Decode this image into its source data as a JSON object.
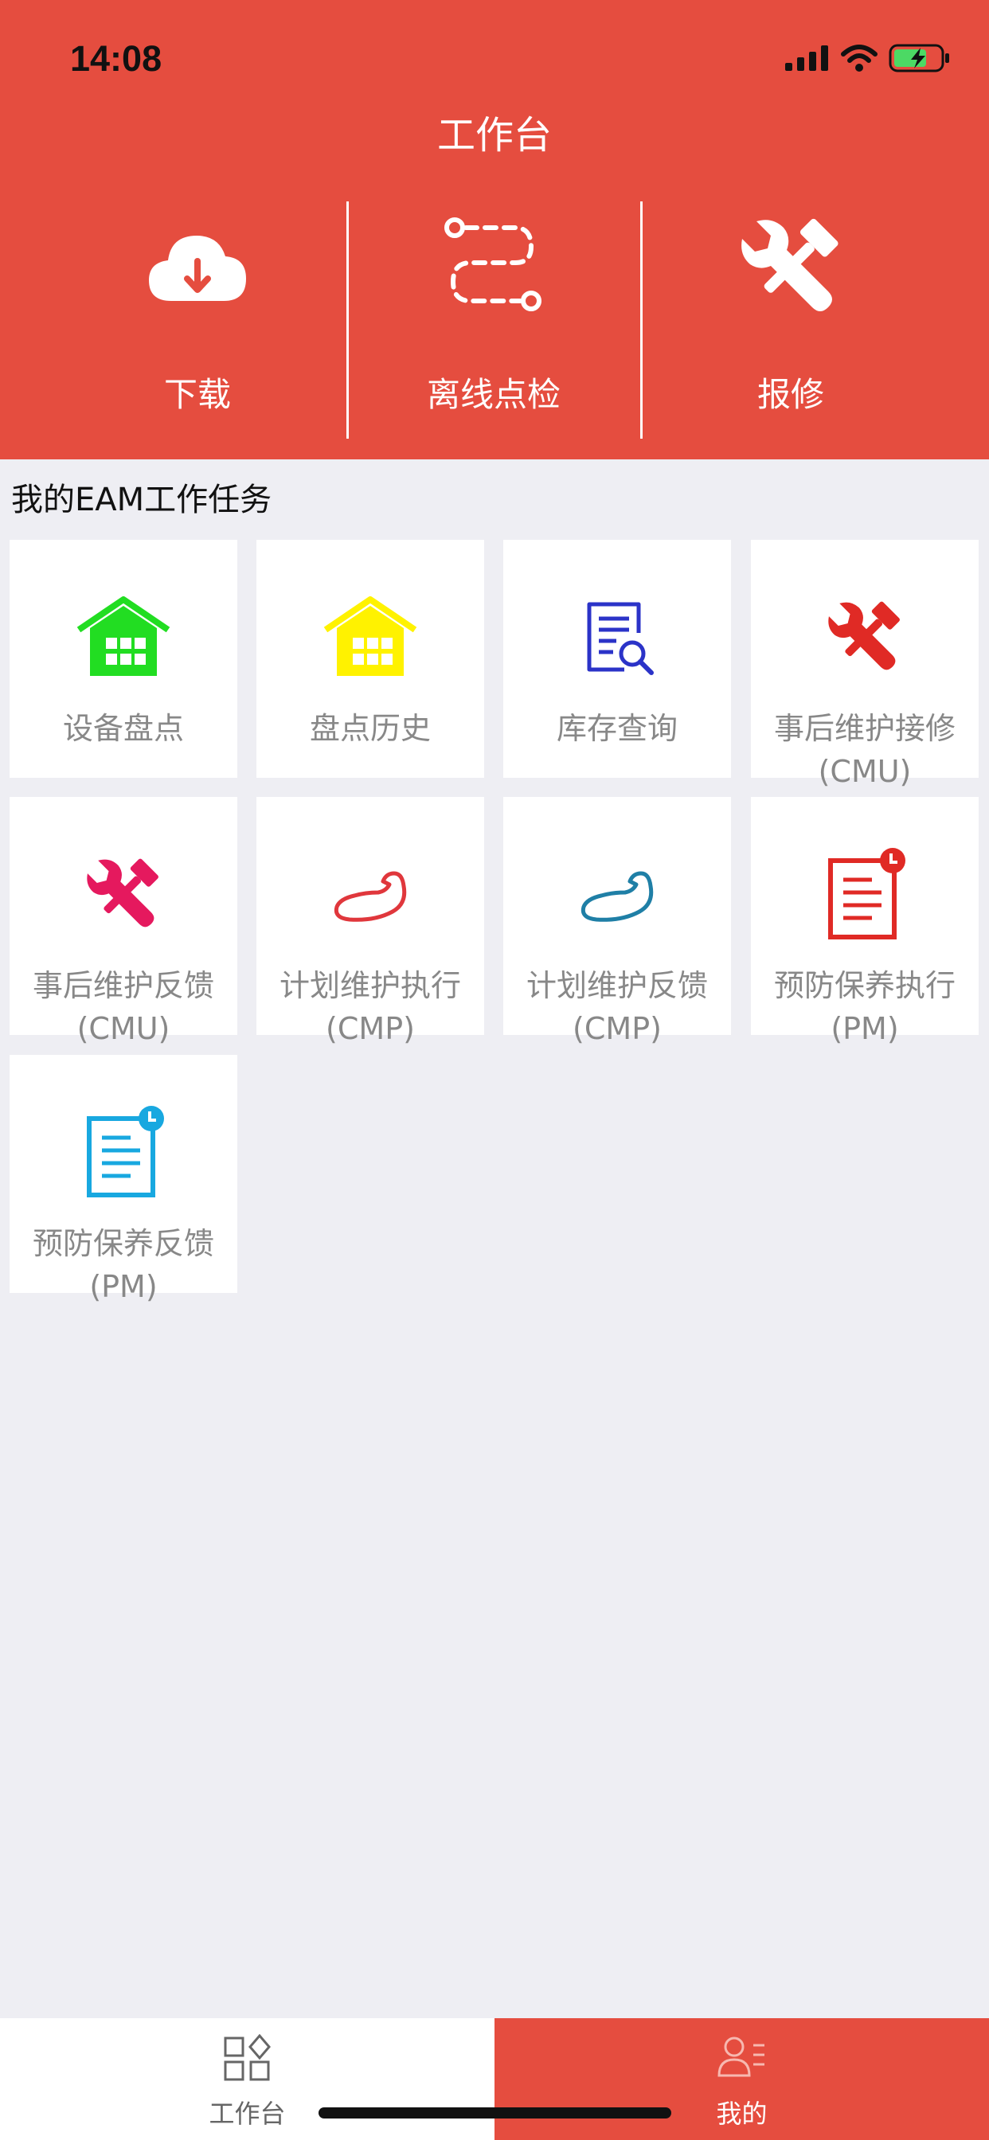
{
  "status_bar": {
    "time": "14:08"
  },
  "header": {
    "title": "工作台",
    "background": "#E54D3F"
  },
  "quick_actions": [
    {
      "label": "下载",
      "icon": "cloud-download-icon"
    },
    {
      "label": "离线点检",
      "icon": "route-path-icon"
    },
    {
      "label": "报修",
      "icon": "wrench-hammer-icon"
    }
  ],
  "section": {
    "title": "我的EAM工作任务"
  },
  "tasks": [
    {
      "label": "设备盘点",
      "icon": "house-grid-icon",
      "color": "#22DD22"
    },
    {
      "label": "盘点历史",
      "icon": "house-grid-icon",
      "color": "#FFF200"
    },
    {
      "label": "库存查询",
      "icon": "document-search-icon",
      "color": "#2B33C8"
    },
    {
      "label": "事后维护接修\n(CMU)",
      "icon": "wrench-hammer-icon",
      "color": "#E02A25"
    },
    {
      "label": "事后维护反馈\n(CMU)",
      "icon": "wrench-hammer-icon",
      "color": "#E5195E"
    },
    {
      "label": "计划维护执行\n(CMP)",
      "icon": "flexed-arm-icon",
      "color": "#E0373C"
    },
    {
      "label": "计划维护反馈\n(CMP)",
      "icon": "flexed-arm-icon",
      "color": "#1F7FA6"
    },
    {
      "label": "预防保养执行\n(PM)",
      "icon": "document-clock-icon",
      "color": "#E02A25"
    },
    {
      "label": "预防保养反馈\n(PM)",
      "icon": "document-clock-icon",
      "color": "#18A8E0"
    }
  ],
  "tabbar": {
    "tabs": [
      {
        "label": "工作台",
        "icon": "grid-diamond-icon",
        "active": false
      },
      {
        "label": "我的",
        "icon": "user-list-icon",
        "active": true
      }
    ]
  }
}
